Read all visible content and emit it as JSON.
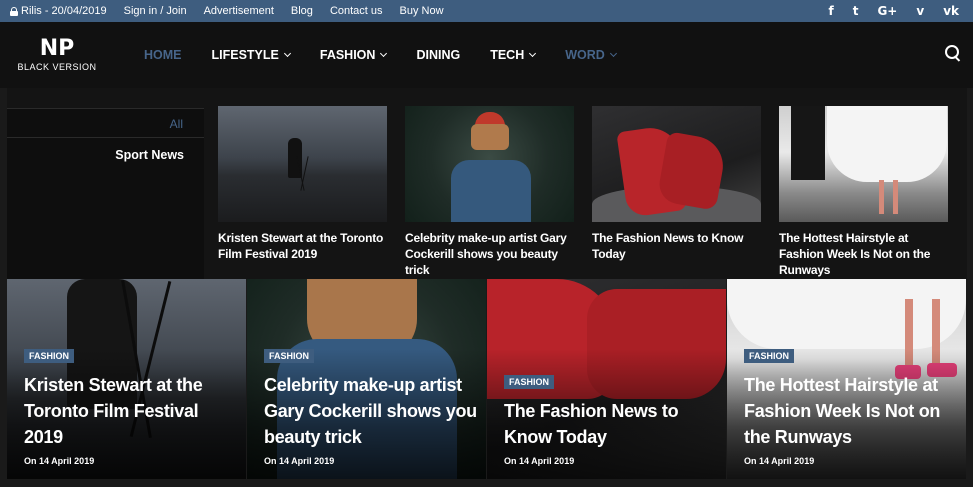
{
  "topbar": {
    "date": "Rilis - 20/04/2019",
    "links": [
      "Sign in / Join",
      "Advertisement",
      "Blog",
      "Contact us",
      "Buy Now"
    ],
    "social": [
      {
        "icon": "facebook-icon",
        "glyph": "f"
      },
      {
        "icon": "twitter-icon",
        "glyph": "t"
      },
      {
        "icon": "googleplus-icon",
        "glyph": "G+"
      },
      {
        "icon": "vimeo-icon",
        "glyph": "v"
      },
      {
        "icon": "vk-icon",
        "glyph": "vk"
      }
    ]
  },
  "header": {
    "logo_main": "NP",
    "logo_sub": "BLACK VERSION",
    "nav": [
      {
        "label": "HOME",
        "dropdown": false
      },
      {
        "label": "LIFESTYLE",
        "dropdown": true
      },
      {
        "label": "FASHION",
        "dropdown": true
      },
      {
        "label": "DINING",
        "dropdown": false
      },
      {
        "label": "TECH",
        "dropdown": true
      },
      {
        "label": "WORD",
        "dropdown": true
      }
    ]
  },
  "mega": {
    "sidebar": {
      "all": "All",
      "category": "Sport News"
    },
    "cards": [
      {
        "title": "Kristen Stewart at the Toronto Film Festival 2019"
      },
      {
        "title": "Celebrity make-up artist Gary Cockerill shows you beauty trick"
      },
      {
        "title": "The Fashion News to Know Today"
      },
      {
        "title": "The Hottest Hairstyle at Fashion Week Is Not on the Runways"
      }
    ]
  },
  "features": [
    {
      "badge": "FASHION",
      "title": "Kristen Stewart at the Toronto Film Festival 2019",
      "date": "On 14 April 2019"
    },
    {
      "badge": "FASHION",
      "title": "Celebrity make-up artist Gary Cockerill shows you beauty trick",
      "date": "On 14 April 2019"
    },
    {
      "badge": "FASHION",
      "title": "The Fashion News to Know Today",
      "date": "On 14 April 2019"
    },
    {
      "badge": "FASHION",
      "title": "The Hottest Hairstyle at Fashion Week Is Not on the Runways",
      "date": "On 14 April 2019"
    }
  ],
  "colors": {
    "accent": "#3e5d7f",
    "nav_dim": "#47658a",
    "background": "#111111"
  }
}
